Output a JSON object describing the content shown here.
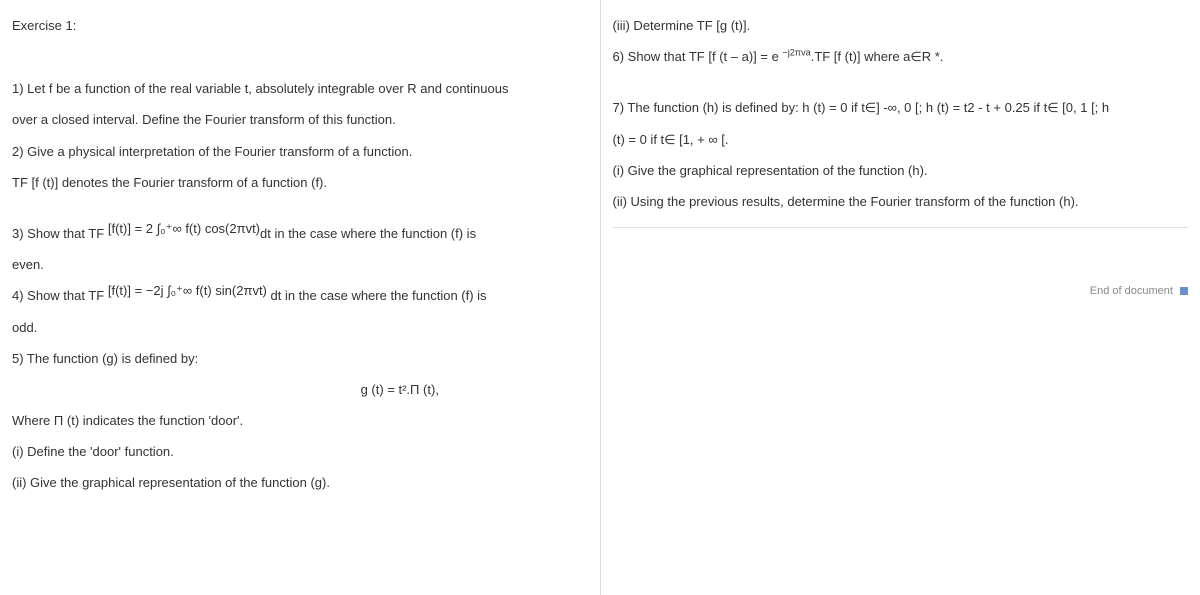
{
  "left": {
    "title": "Exercise 1:",
    "q1a": "1) Let f be a function of the real variable t, absolutely integrable over R and continuous",
    "q1b": "over a closed interval. Define the Fourier transform of this function.",
    "q2": "2) Give a physical interpretation of the Fourier transform of a function.",
    "note": "TF [f (t)] denotes the Fourier transform of a function (f).",
    "q3pre": "3) Show that TF ",
    "q3formula": "[f(t)] = 2 ∫₀⁺∞ f(t) cos(2πvt)",
    "q3post": "dt in the case where the function (f) is",
    "q3end": "even.",
    "q4pre": "4) Show that TF ",
    "q4formula": "[f(t)] = −2j ∫₀⁺∞ f(t) sin(2πvt) ",
    "q4post": "dt in the case where the function (f) is",
    "q4end": "odd.",
    "q5": "5) The function (g) is defined by:",
    "q5formula": "g (t) = t².Π (t),",
    "q5where": "Where Π (t) indicates the function 'door'.",
    "q5i": "(i) Define the 'door' function.",
    "q5ii": "(ii) Give the graphical representation of the function (g)."
  },
  "right": {
    "q5iii": "(iii) Determine TF [g (t)].",
    "q6pre": "6) Show that TF [f (t – a)] = e ",
    "q6exp": "−j2πva",
    "q6post": ".TF [f (t)] where a∈R *.",
    "q7a": "7) The function (h) is defined by: h (t) = 0 if t∈] -∞, 0 [; h (t) = t2 - t + 0.25 if t∈ [0, 1 [; h",
    "q7b": "(t) = 0 if t∈ [1, + ∞ [.",
    "q7i": "(i) Give the graphical representation of the function (h).",
    "q7ii": "(ii) Using the previous results, determine the Fourier transform of the function (h).",
    "end": "End of document"
  }
}
